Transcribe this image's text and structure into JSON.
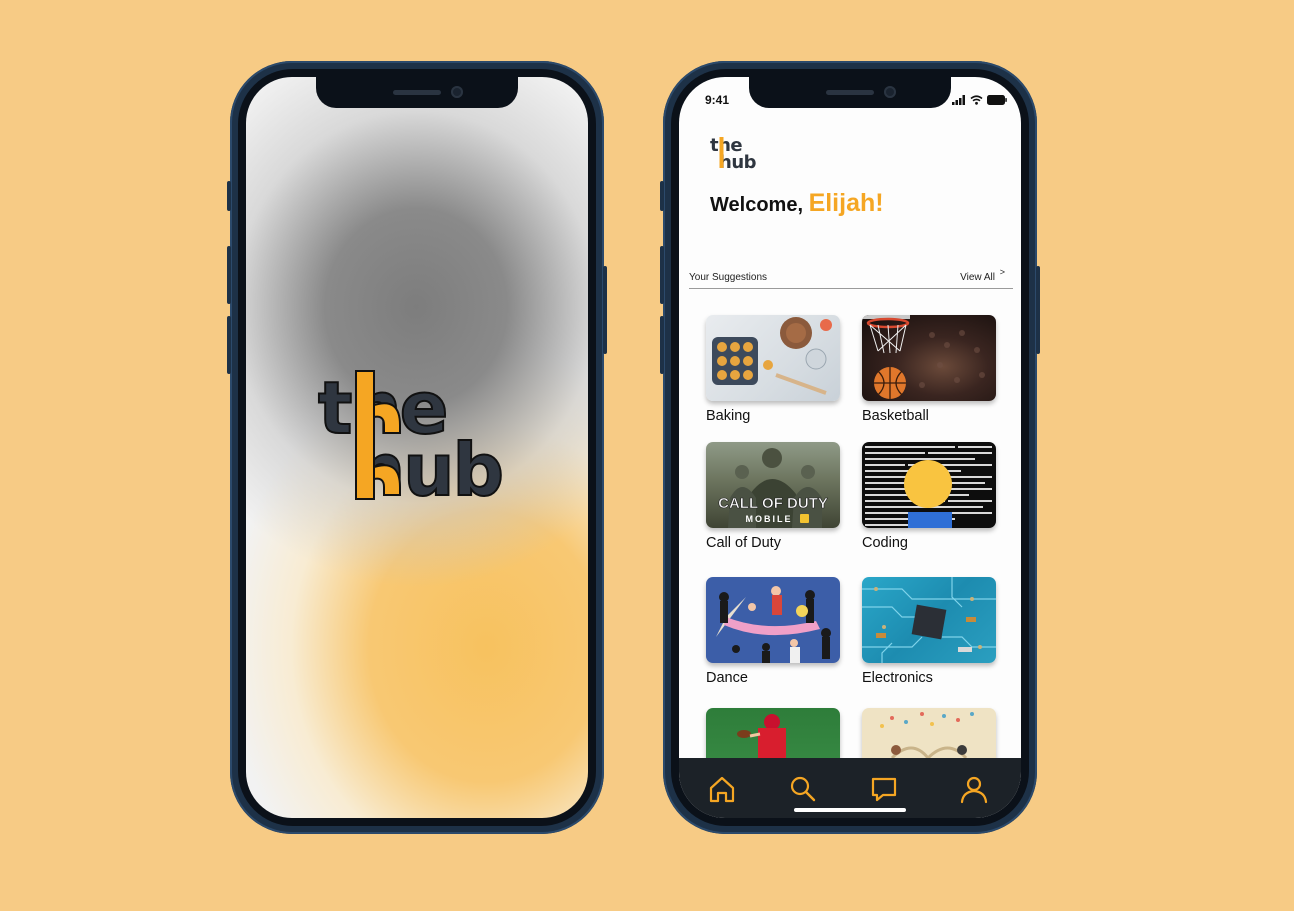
{
  "colors": {
    "background": "#F7CB85",
    "accent": "#F5A623",
    "dark_text": "#2f3640",
    "tabbar": "#1c2228"
  },
  "splash": {
    "logo": {
      "word_top": "the",
      "word_bottom": "hub"
    }
  },
  "app": {
    "status_bar": {
      "time": "9:41",
      "icons": [
        "signal-icon",
        "wifi-icon",
        "battery-icon"
      ]
    },
    "logo": {
      "word_top": "the",
      "word_bottom": "hub"
    },
    "welcome": {
      "greeting": "Welcome,",
      "name": "Elijah!"
    },
    "suggestions": {
      "title": "Your Suggestions",
      "view_all": "View All",
      "view_all_arrow": ">",
      "items": [
        {
          "label": "Baking"
        },
        {
          "label": "Basketball"
        },
        {
          "label": "Call of Duty",
          "image_text": "CALL OF DUTY",
          "image_subtext": "MOBILE"
        },
        {
          "label": "Coding"
        },
        {
          "label": "Dance"
        },
        {
          "label": "Electronics"
        },
        {
          "label": ""
        },
        {
          "label": ""
        }
      ]
    },
    "tabbar": {
      "tabs": [
        "home-icon",
        "search-icon",
        "chat-icon",
        "profile-icon"
      ]
    }
  }
}
